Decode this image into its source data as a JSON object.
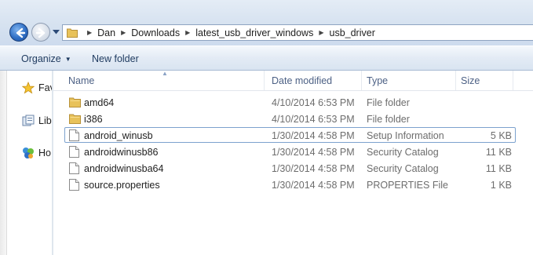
{
  "address": {
    "breadcrumbs": [
      "Dan",
      "Downloads",
      "latest_usb_driver_windows",
      "usb_driver"
    ]
  },
  "toolbar": {
    "organize_label": "Organize",
    "new_folder_label": "New folder"
  },
  "nav_pane": {
    "items": [
      {
        "label": "Fav",
        "icon": "star-icon"
      },
      {
        "label": "Lib",
        "icon": "libraries-icon"
      },
      {
        "label": "Ho",
        "icon": "homegroup-icon"
      }
    ]
  },
  "columns": {
    "name": "Name",
    "date": "Date modified",
    "type": "Type",
    "size": "Size"
  },
  "files": [
    {
      "name": "amd64",
      "date": "4/10/2014 6:53 PM",
      "type": "File folder",
      "size": "",
      "icon": "folder-icon"
    },
    {
      "name": "i386",
      "date": "4/10/2014 6:53 PM",
      "type": "File folder",
      "size": "",
      "icon": "folder-icon"
    },
    {
      "name": "android_winusb",
      "date": "1/30/2014 4:58 PM",
      "type": "Setup Information",
      "size": "5 KB",
      "icon": "file-icon"
    },
    {
      "name": "androidwinusb86",
      "date": "1/30/2014 4:58 PM",
      "type": "Security Catalog",
      "size": "11 KB",
      "icon": "file-icon"
    },
    {
      "name": "androidwinusba64",
      "date": "1/30/2014 4:58 PM",
      "type": "Security Catalog",
      "size": "11 KB",
      "icon": "file-icon"
    },
    {
      "name": "source.properties",
      "date": "1/30/2014 4:58 PM",
      "type": "PROPERTIES File",
      "size": "1 KB",
      "icon": "file-icon"
    }
  ],
  "colors": {
    "header_text": "#4d6185",
    "focus_border": "#7da2ce",
    "folder_yellow": "#e8c25a"
  }
}
